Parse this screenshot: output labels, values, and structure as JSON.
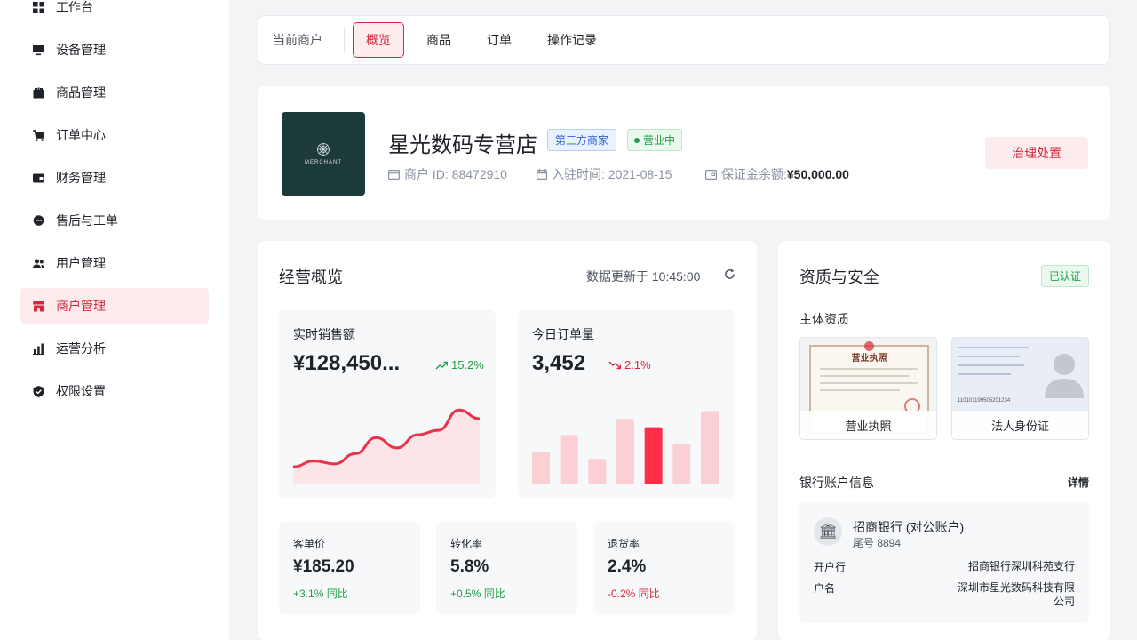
{
  "sidebar": {
    "items": [
      {
        "label": "工作台",
        "icon": "grid-icon"
      },
      {
        "label": "设备管理",
        "icon": "monitor-icon"
      },
      {
        "label": "商品管理",
        "icon": "box-icon"
      },
      {
        "label": "订单中心",
        "icon": "cart-icon"
      },
      {
        "label": "财务管理",
        "icon": "wallet-icon"
      },
      {
        "label": "售后与工单",
        "icon": "chat-icon"
      },
      {
        "label": "用户管理",
        "icon": "users-icon"
      },
      {
        "label": "商户管理",
        "icon": "store-icon",
        "active": true
      },
      {
        "label": "运营分析",
        "icon": "bar-chart-icon"
      },
      {
        "label": "权限设置",
        "icon": "shield-icon"
      }
    ]
  },
  "tabs": {
    "label": "当前商户",
    "items": [
      "概览",
      "商品",
      "订单",
      "操作记录"
    ],
    "active": "概览"
  },
  "merchant": {
    "logo_text": "MERCHANT",
    "name": "星光数码专营店",
    "type_badge": "第三方商家",
    "status_badge": "营业中",
    "id_text": "商户 ID: 88472910",
    "join_text": "入驻时间: 2021-08-15",
    "deposit_label": "保证金余额:",
    "deposit_value": "¥50,000.00",
    "action_label": "治理处置"
  },
  "overview": {
    "title": "经营概览",
    "update_text": "数据更新于 10:45:00",
    "sales": {
      "label": "实时销售额",
      "value": "¥128,450...",
      "trend": "15.2%",
      "trend_dir": "up"
    },
    "orders": {
      "label": "今日订单量",
      "value": "3,452",
      "trend": "2.1%",
      "trend_dir": "down"
    },
    "sales_sparkline": [
      12,
      20,
      16,
      30,
      52,
      38,
      56,
      62,
      90,
      78
    ],
    "orders_bars": [
      38,
      58,
      30,
      77,
      67,
      48,
      86
    ],
    "orders_bars_highlight_index": 4,
    "kpis": [
      {
        "label": "客单价",
        "value": "¥185.20",
        "delta": "+3.1% 同比",
        "dir": "up"
      },
      {
        "label": "转化率",
        "value": "5.8%",
        "delta": "+0.5% 同比",
        "dir": "up"
      },
      {
        "label": "退货率",
        "value": "2.4%",
        "delta": "-0.2% 同比",
        "dir": "down"
      }
    ]
  },
  "security": {
    "title": "资质与安全",
    "verified_badge": "已认证",
    "qual_title": "主体资质",
    "docs": [
      {
        "caption": "营业执照",
        "header": "营业执照"
      },
      {
        "caption": "法人身份证",
        "id_number": "110101199505201234"
      }
    ],
    "bank_title": "银行账户信息",
    "detail_link": "详情",
    "bank": {
      "name": "招商银行 (对公账户)",
      "tail": "尾号 8894",
      "branch_label": "开户行",
      "branch_value": "招商银行深圳科苑支行",
      "holder_label": "户名",
      "holder_value_1": "深圳市星光数码科技有限",
      "holder_value_2": "公司"
    }
  },
  "colors": {
    "accent": "#d9263b",
    "accent_bg": "#fdecee",
    "success": "#1f9d48",
    "bar": "#fbd0d5"
  }
}
